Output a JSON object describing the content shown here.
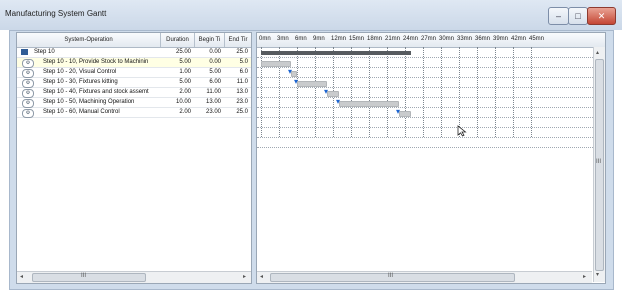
{
  "window": {
    "title": "Manufacturing System Gantt",
    "minimize": "–",
    "maximize": "□",
    "close": "✕"
  },
  "colors": {
    "accent": "#1c64d0",
    "summary_bar": "#575b5f",
    "task_bar": "#c9cbcd",
    "selected_row": "#ffffe4"
  },
  "table": {
    "headers": [
      "System-Operation",
      "Duration",
      "Begin Ti",
      "End Tir"
    ],
    "rows": [
      {
        "name": "Step 10",
        "duration": "25.00",
        "begin": "0.00",
        "end": "25.0",
        "icon": "step-root-icon"
      },
      {
        "name": "Step 10 - 10, Provide Stock to Machinin",
        "duration": "5.00",
        "begin": "0.00",
        "end": "5.0",
        "icon": "operation-icon"
      },
      {
        "name": "Step 10 - 20, Visual Control",
        "duration": "1.00",
        "begin": "5.00",
        "end": "6.0",
        "icon": "operation-icon"
      },
      {
        "name": "Step 10 - 30, Fixtures kitting",
        "duration": "5.00",
        "begin": "6.00",
        "end": "11.0",
        "icon": "operation-icon"
      },
      {
        "name": "Step 10 - 40, Fixtures and stock assemt",
        "duration": "2.00",
        "begin": "11.00",
        "end": "13.0",
        "icon": "operation-icon"
      },
      {
        "name": "Step 10 - 50, Machining Operation",
        "duration": "10.00",
        "begin": "13.00",
        "end": "23.0",
        "icon": "operation-icon"
      },
      {
        "name": "Step 10 - 60, Manual Control",
        "duration": "2.00",
        "begin": "23.00",
        "end": "25.0",
        "icon": "operation-icon"
      }
    ]
  },
  "timeline": {
    "ticks": [
      "0mn",
      "3mn",
      "6mn",
      "9mn",
      "12mn",
      "15mn",
      "18mn",
      "21mn",
      "24mn",
      "27mn",
      "30mn",
      "33mn",
      "36mn",
      "39mn",
      "42mn",
      "45mn"
    ],
    "tick_minutes": [
      0,
      3,
      6,
      9,
      12,
      15,
      18,
      21,
      24,
      27,
      30,
      33,
      36,
      39,
      42,
      45
    ],
    "summary": {
      "begin": 0,
      "end": 25
    },
    "tasks": [
      {
        "begin": 0,
        "end": 5
      },
      {
        "begin": 5,
        "end": 6
      },
      {
        "begin": 6,
        "end": 11
      },
      {
        "begin": 11,
        "end": 13
      },
      {
        "begin": 13,
        "end": 23
      },
      {
        "begin": 23,
        "end": 25
      }
    ]
  },
  "scroll": {
    "left": "◂",
    "right": "▸",
    "up": "▴",
    "down": "▾",
    "grip": "III"
  }
}
